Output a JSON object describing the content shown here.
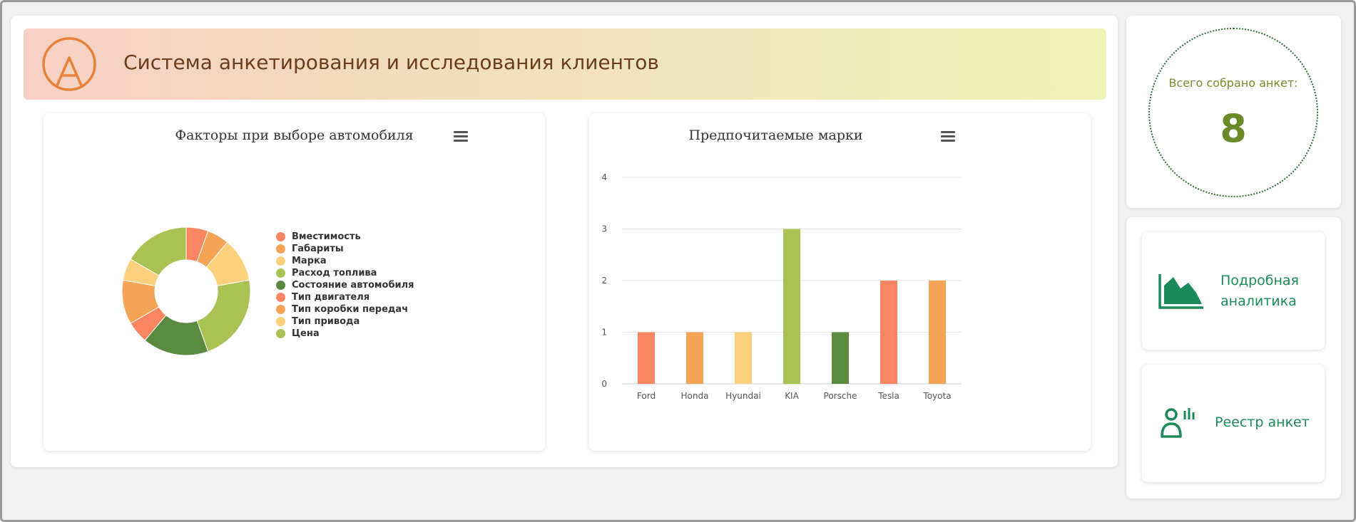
{
  "header": {
    "title": "Система анкетирования и исследования клиентов",
    "logo_icon": "letter-a-circle-logo",
    "colors": {
      "logo": "#e8823a",
      "title": "#6b3d1a"
    }
  },
  "pie_card": {
    "title": "Факторы при выборе автомобиля",
    "menu_icon": "hamburger-icon"
  },
  "bar_card": {
    "title": "Предпочитаемые марки",
    "menu_icon": "hamburger-icon"
  },
  "chart_data": [
    {
      "type": "pie",
      "donut": true,
      "title": "Факторы при выборе автомобиля",
      "legend_position": "right",
      "slices": [
        {
          "label": "Вместимость",
          "value": 1,
          "color": "#f98660"
        },
        {
          "label": "Габариты",
          "value": 1,
          "color": "#f5a455"
        },
        {
          "label": "Марка",
          "value": 2,
          "color": "#fcd07d"
        },
        {
          "label": "Расход топлива",
          "value": 4,
          "color": "#aac254"
        },
        {
          "label": "Состояние автомобиля",
          "value": 3,
          "color": "#5a8a40"
        },
        {
          "label": "Тип двигателя",
          "value": 1,
          "color": "#f98660"
        },
        {
          "label": "Тип коробки передач",
          "value": 2,
          "color": "#f5a455"
        },
        {
          "label": "Тип привода",
          "value": 1,
          "color": "#fcd07d"
        },
        {
          "label": "Цена",
          "value": 3,
          "color": "#aac254"
        }
      ]
    },
    {
      "type": "bar",
      "title": "Предпочитаемые марки",
      "categories": [
        "Ford",
        "Honda",
        "Hyundai",
        "KIA",
        "Porsche",
        "Tesla",
        "Toyota"
      ],
      "values": [
        1,
        1,
        1,
        3,
        1,
        2,
        2
      ],
      "colors": [
        "#f98660",
        "#f5a455",
        "#fcd07d",
        "#aac254",
        "#5a8a40",
        "#f98660",
        "#f5a455"
      ],
      "ylim": [
        0,
        4
      ],
      "yticks": [
        "0",
        "1",
        "2",
        "3",
        "4"
      ],
      "grid": true,
      "legend": false
    }
  ],
  "counter": {
    "label": "Всего собрано анкет:",
    "value": "8"
  },
  "nav": {
    "analytics": {
      "label_line1": "Подробная",
      "label_line2": "аналитика",
      "icon": "area-chart-icon"
    },
    "registry": {
      "label": "Реестр анкет",
      "icon": "user-chart-icon"
    },
    "color": "#1b8a5a"
  }
}
